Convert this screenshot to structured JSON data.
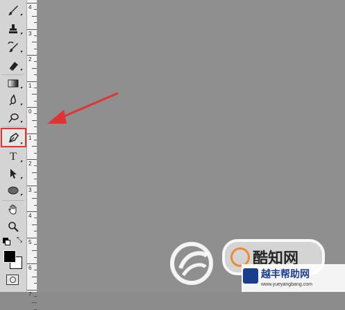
{
  "ruler": {
    "labels": [
      "4",
      "3",
      "2",
      "1",
      "0",
      "1",
      "2",
      "3",
      "4",
      "5",
      "6",
      "7"
    ]
  },
  "tools": [
    {
      "name": "brush-tool",
      "icon": "brush-icon"
    },
    {
      "name": "clone-stamp-tool",
      "icon": "stamp-icon"
    },
    {
      "name": "history-brush-tool",
      "icon": "history-brush-icon"
    },
    {
      "name": "eraser-tool",
      "icon": "eraser-icon"
    },
    {
      "name": "gradient-tool",
      "icon": "gradient-icon"
    },
    {
      "name": "blur-tool",
      "icon": "blur-icon"
    },
    {
      "name": "dodge-tool",
      "icon": "dodge-icon"
    },
    {
      "name": "pen-tool",
      "icon": "pen-icon",
      "selected": true
    },
    {
      "name": "type-tool",
      "icon": "type-icon",
      "glyph": "T"
    },
    {
      "name": "path-selection-tool",
      "icon": "path-select-icon"
    },
    {
      "name": "shape-tool",
      "icon": "ellipse-icon"
    },
    {
      "name": "hand-tool",
      "icon": "hand-icon"
    },
    {
      "name": "zoom-tool",
      "icon": "zoom-icon"
    }
  ],
  "colors": {
    "toolbar_bg": "#d4d4d4",
    "canvas_bg": "#8f8f8f",
    "highlight": "#e03434",
    "arrow": "#e03434"
  },
  "watermark": {
    "brand_text": "酷知网",
    "overlay_text": "越丰帮助网",
    "url": "www.yueyangbang.com"
  }
}
